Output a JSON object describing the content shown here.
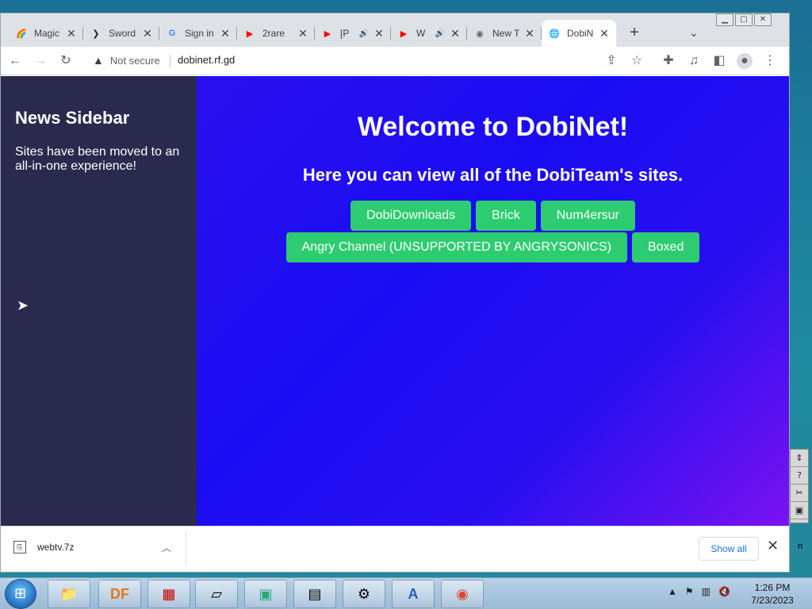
{
  "browser": {
    "tabs": [
      {
        "title": "Magic",
        "fav": "🌈",
        "favColor": "#e74c3c"
      },
      {
        "title": "Sword",
        "fav": "❯",
        "favColor": "#222"
      },
      {
        "title": "Sign in",
        "fav": "G",
        "favColor": "#4285f4"
      },
      {
        "title": "2rare",
        "fav": "▶",
        "favColor": "#ff0000"
      },
      {
        "title": "[P",
        "fav": "▶",
        "favColor": "#ff0000",
        "speaker": "🔊"
      },
      {
        "title": "W",
        "fav": "▶",
        "favColor": "#ff0000",
        "speaker": "🔊"
      },
      {
        "title": "New T",
        "fav": "◉",
        "favColor": "#5f6368"
      },
      {
        "title": "DobiN",
        "fav": "🌐",
        "favColor": "#5f6368",
        "active": true
      }
    ],
    "new_tab_label": "+",
    "tab_search_icon": "chevron-down-icon",
    "security_label": "Not secure",
    "url": "dobinet.rf.gd"
  },
  "page": {
    "sidebar_title": "News Sidebar",
    "sidebar_text": "Sites have been moved to an all-in-one experience!",
    "heading": "Welcome to DobiNet!",
    "subheading": "Here you can view all of the DobiTeam's sites.",
    "buttons": [
      "DobiDownloads",
      "Brick",
      "Num4ersur",
      "Angry Channel (UNSUPPORTED BY ANGRYSONICS)",
      "Boxed"
    ],
    "button_color": "#2ecc71"
  },
  "downloads": {
    "file_name": "webtv.7z",
    "show_all_label": "Show all"
  },
  "taskbar": {
    "items": [
      "folder",
      "DF",
      "game",
      "notepad",
      "terminal",
      "doc",
      "setup",
      "wordpad",
      "chrome"
    ],
    "time": "1:26 PM",
    "date": "7/23/2023"
  }
}
